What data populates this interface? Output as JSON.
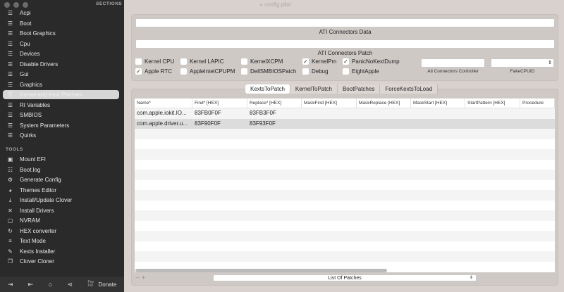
{
  "window": {
    "title": "config.plist"
  },
  "sidebar": {
    "sections_label": "SECTIONS",
    "sections": [
      {
        "label": "Acpi",
        "icon": "list-icon"
      },
      {
        "label": "Boot",
        "icon": "list-icon"
      },
      {
        "label": "Boot Graphics",
        "icon": "list-icon"
      },
      {
        "label": "Cpu",
        "icon": "list-icon"
      },
      {
        "label": "Devices",
        "icon": "list-icon"
      },
      {
        "label": "Disable Drivers",
        "icon": "list-icon"
      },
      {
        "label": "Gui",
        "icon": "list-icon"
      },
      {
        "label": "Graphics",
        "icon": "list-icon"
      },
      {
        "label": "Kernel and Kext Patches",
        "icon": "list-icon",
        "selected": true
      },
      {
        "label": "Rt Variables",
        "icon": "list-icon"
      },
      {
        "label": "SMBIOS",
        "icon": "list-icon"
      },
      {
        "label": "System Parameters",
        "icon": "list-icon"
      },
      {
        "label": "Quirks",
        "icon": "list-icon"
      }
    ],
    "tools_label": "TOOLS",
    "tools": [
      {
        "label": "Mount EFI",
        "icon": "disk-icon"
      },
      {
        "label": "Boot.log",
        "icon": "log-search-icon"
      },
      {
        "label": "Generate Config",
        "icon": "gears-icon"
      },
      {
        "label": "Themes Editor",
        "icon": "palette-icon"
      },
      {
        "label": "Install/Update Clover",
        "icon": "download-icon"
      },
      {
        "label": "Install Drivers",
        "icon": "tools-icon"
      },
      {
        "label": "NVRAM",
        "icon": "chip-icon"
      },
      {
        "label": "HEX converter",
        "icon": "refresh-icon"
      },
      {
        "label": "Text Mode",
        "icon": "text-icon"
      },
      {
        "label": "Kexts Installer",
        "icon": "plug-icon"
      },
      {
        "label": "Clover Cloner",
        "icon": "copy-icon"
      }
    ],
    "bottom": {
      "donate_label": "Donate",
      "paypal_label": "Pay Pal"
    }
  },
  "top": {
    "ati_data_label": "ATI Connectors Data",
    "ati_patch_label": "ATI Connectors Patch",
    "checkboxes": [
      {
        "label": "Kernel CPU",
        "checked": false
      },
      {
        "label": "Kernel LAPIC",
        "checked": false
      },
      {
        "label": "KernelXCPM",
        "checked": false
      },
      {
        "label": "KernelPm",
        "checked": true
      },
      {
        "label": "PanicNoKextDump",
        "checked": true
      },
      {
        "label": "Apple RTC",
        "checked": true
      },
      {
        "label": "AppleIntelCPUPM",
        "checked": false
      },
      {
        "label": "DellSMBIOSPatch",
        "checked": false
      },
      {
        "label": "Debug",
        "checked": false
      },
      {
        "label": "EightApple",
        "checked": false
      }
    ],
    "ati_controller_label": "Ati Connectors Controller",
    "fakecpuid_label": "FakeCPUID"
  },
  "tabs": [
    {
      "label": "KextsToPatch",
      "active": true
    },
    {
      "label": "KernelToPatch"
    },
    {
      "label": "BootPatches"
    },
    {
      "label": "ForceKextsToLoad"
    }
  ],
  "table": {
    "columns": [
      "Name*",
      "Find* [HEX]",
      "Replace* [HEX]",
      "MaskFind [HEX]",
      "MaskReplace [HEX]",
      "MaskStart [HEX]",
      "StartPattern [HEX]",
      "Procedure"
    ],
    "rows": [
      [
        "com.apple.iokit.IO...",
        "83FB0F0F",
        "83FB3F0F",
        "",
        "",
        "",
        "",
        ""
      ],
      [
        "com.apple.driver.u...",
        "83F90F0F",
        "83F93F0F",
        "",
        "",
        "",
        "",
        ""
      ]
    ]
  },
  "bottom": {
    "minus": "−",
    "plus": "+",
    "popup_value": "List Of Patches"
  }
}
